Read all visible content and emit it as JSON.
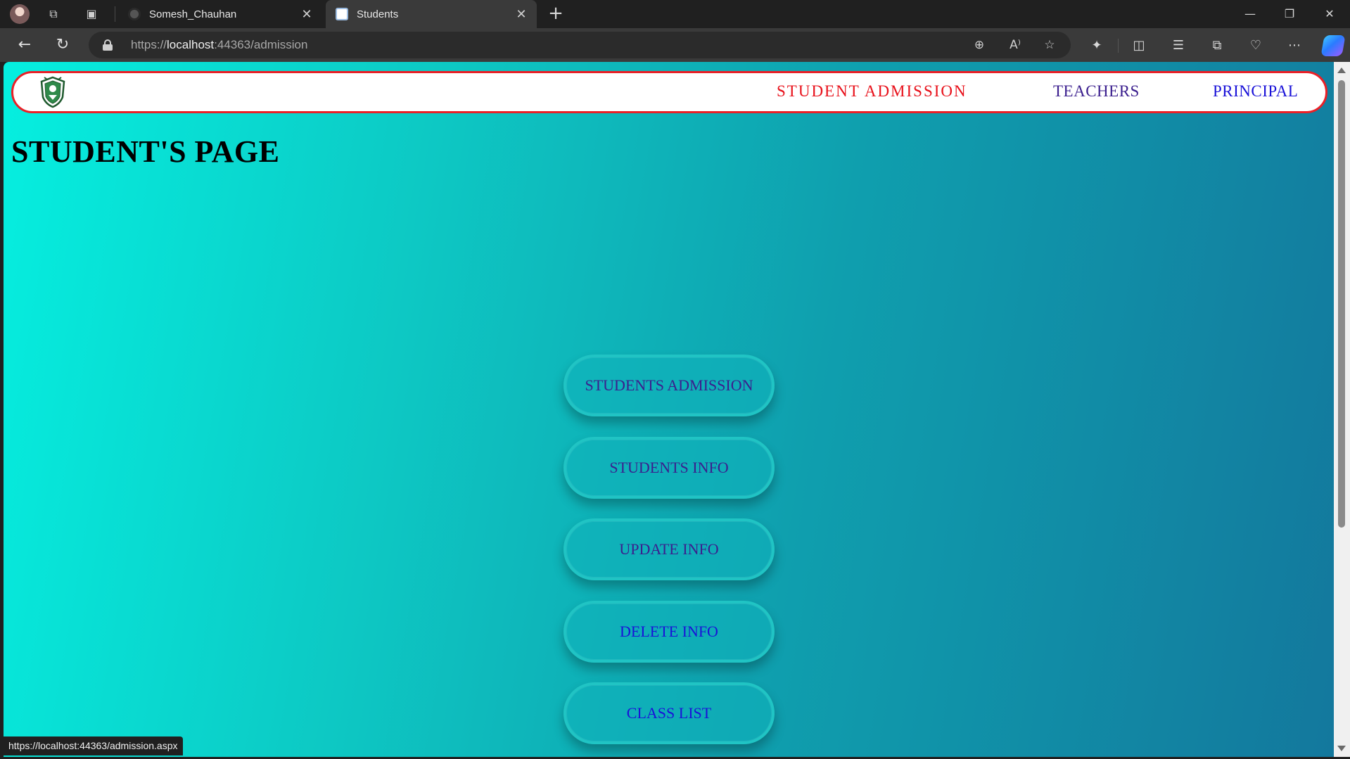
{
  "browser": {
    "tabs": [
      {
        "title": "Somesh_Chauhan",
        "active": false
      },
      {
        "title": "Students",
        "active": true
      }
    ],
    "address": {
      "scheme": "https://",
      "host": "localhost",
      "rest": ":44363/admission"
    },
    "status_url": "https://localhost:44363/admission.aspx",
    "icons": {
      "back": "←",
      "refresh": "↻",
      "workspaces": "⧉",
      "tab_actions": "▣",
      "close": "✕",
      "new_tab": "+",
      "minimize": "—",
      "restore": "❐",
      "window_close": "✕",
      "zoom": "⊕",
      "read_aloud": "A⁾",
      "favorite": "☆",
      "extensions": "✦",
      "split": "◫",
      "favorites": "☰",
      "collections": "⧉",
      "health": "♡",
      "more": "⋯"
    }
  },
  "site": {
    "nav": {
      "admission": "STUDENT ADMISSION",
      "teachers": "TEACHERS",
      "principal": "PRINCIPAL"
    },
    "page_title": "STUDENT'S PAGE",
    "buttons": [
      "STUDENTS ADMISSION",
      "STUDENTS INFO",
      "UPDATE INFO",
      "DELETE INFO",
      "CLASS LIST"
    ],
    "colors": {
      "nav_border": "#ea2027",
      "admission_link": "#e8101a",
      "visited_link": "#3b1f8e",
      "link": "#1a12d8"
    }
  }
}
